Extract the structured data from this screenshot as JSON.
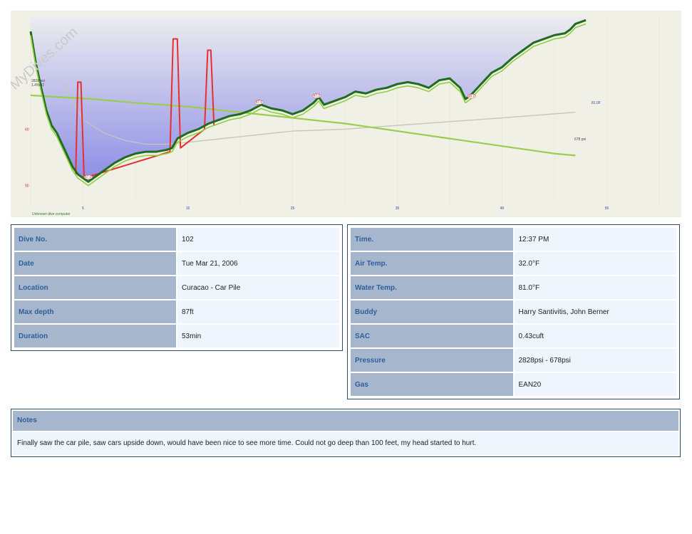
{
  "watermark": "MyDives.com",
  "chart_data": {
    "type": "line",
    "xlim": [
      0,
      60
    ],
    "ylim": [
      0,
      100
    ],
    "x_ticks": [
      "5",
      "15",
      "25",
      "35",
      "45",
      "55"
    ],
    "y_ticks": [
      "60",
      "90"
    ],
    "computer_label": "Unknown dive computer",
    "annotations": [
      {
        "x": 5.5,
        "y": 87.0,
        "label": "87.0"
      },
      {
        "x": 21.8,
        "y": 47.2,
        "label": "47.0"
      },
      {
        "x": 27.3,
        "y": 43.8,
        "label": "47.0"
      },
      {
        "x": 42.1,
        "y": 44.0,
        "label": "46.0"
      }
    ],
    "series": [
      {
        "color": "#1f6b1f",
        "x": [
          0,
          0.5,
          1,
          1.5,
          2,
          2.5,
          3,
          3.5,
          4,
          4.5,
          5,
          5.5,
          6,
          7,
          8,
          9,
          10,
          11,
          12,
          13,
          13.5,
          14,
          15,
          16,
          17,
          18,
          19,
          20,
          21,
          22,
          23,
          24,
          25,
          26,
          27,
          27.5,
          28,
          29,
          30,
          31,
          32,
          33,
          34,
          35,
          36,
          37,
          38,
          39,
          40,
          41,
          41.5,
          42,
          43,
          44,
          45,
          46,
          47,
          48,
          49,
          50,
          51,
          51.5,
          52,
          53
        ],
        "y": [
          8,
          25,
          38,
          50,
          58,
          62,
          68,
          74,
          80,
          84,
          86,
          88,
          86,
          82,
          78,
          75,
          73,
          72,
          72,
          71,
          70,
          65,
          62,
          60,
          57,
          55,
          53,
          52,
          50,
          47,
          49,
          50,
          52,
          50,
          46,
          43,
          47,
          45,
          43,
          40,
          41,
          39,
          38,
          36,
          35,
          36,
          38,
          34,
          33,
          38,
          44,
          42,
          36,
          30,
          27,
          22,
          18,
          14,
          12,
          10,
          9,
          7,
          4,
          2
        ]
      },
      {
        "color": "#8fcf3f",
        "x": [
          0,
          0.5,
          1,
          1.5,
          2,
          2.5,
          3,
          3.5,
          4,
          4.5,
          5,
          5.5,
          6,
          7,
          8,
          9,
          10,
          11,
          12,
          13,
          13.5,
          14,
          15,
          16,
          17,
          18,
          19,
          20,
          21,
          22,
          23,
          24,
          25,
          26,
          27,
          27.5,
          28,
          29,
          30,
          31,
          32,
          33,
          34,
          35,
          36,
          37,
          38,
          39,
          40,
          41,
          41.5,
          42,
          43,
          44,
          45,
          46,
          47,
          48,
          49,
          50,
          51,
          51.5,
          52,
          53
        ],
        "y": [
          10,
          27,
          40,
          52,
          60,
          64,
          70,
          76,
          82,
          86,
          88,
          90,
          88,
          84,
          80,
          77,
          75,
          74,
          74,
          73,
          72,
          67,
          64,
          62,
          59,
          57,
          55,
          54,
          52,
          49,
          51,
          52,
          54,
          52,
          48,
          45,
          49,
          47,
          45,
          42,
          43,
          41,
          40,
          38,
          37,
          38,
          40,
          36,
          35,
          40,
          46,
          44,
          38,
          32,
          29,
          24,
          20,
          16,
          14,
          12,
          11,
          9,
          6,
          4
        ]
      },
      {
        "color": "#e53030",
        "x": [
          4.3,
          4.5,
          4.8,
          5.1,
          13.3,
          13.6,
          14.0,
          14.3,
          16.6,
          16.9,
          17.2,
          17.5
        ],
        "y": [
          84,
          35,
          35,
          86,
          72,
          12,
          12,
          70,
          60,
          18,
          18,
          58
        ]
      },
      {
        "color": "#9acd4b",
        "x": [
          0,
          3,
          6,
          10,
          15,
          20,
          25,
          30,
          35,
          40,
          45,
          50,
          52
        ],
        "y": [
          42,
          43,
          44,
          46,
          48,
          51,
          54,
          57,
          61,
          65,
          69,
          73,
          74
        ]
      },
      {
        "color": "#c8c4be",
        "x": [
          3,
          5,
          7,
          9,
          11,
          13,
          15,
          20,
          25,
          30,
          35,
          40,
          45,
          52
        ],
        "y": [
          35,
          55,
          62,
          66,
          68,
          68,
          67,
          64,
          61,
          60,
          58,
          56,
          54,
          51
        ]
      }
    ],
    "pressure_start_label": "2828 psi",
    "pressure_start_sub": "1.4%O2",
    "pressure_end_label": "678 psi",
    "temp_end_label": "81.0F"
  },
  "dive_info": [
    {
      "label": "Dive No.",
      "value": "102"
    },
    {
      "label": "Date",
      "value": "Tue Mar 21, 2006"
    },
    {
      "label": "Location",
      "value": "Curacao - Car Pile"
    },
    {
      "label": "Max depth",
      "value": "87ft"
    },
    {
      "label": "Duration",
      "value": "53min"
    }
  ],
  "conditions": [
    {
      "label": "Time.",
      "value": "12:37 PM"
    },
    {
      "label": "Air Temp.",
      "value": "32.0°F"
    },
    {
      "label": "Water Temp.",
      "value": "81.0°F"
    },
    {
      "label": "Buddy",
      "value": "Harry Santivitis, John Berner"
    },
    {
      "label": "SAC",
      "value": "0.43cuft"
    },
    {
      "label": "Pressure",
      "value": "2828psi - 678psi"
    },
    {
      "label": "Gas",
      "value": "EAN20"
    }
  ],
  "notes": {
    "title": "Notes",
    "text": "Finally saw the car pile, saw cars upside down, would have been nice to see more time. Could not go deep than 100 feet, my head started to hurt."
  },
  "colors": {
    "plot_bg": "#f1f0e6",
    "fill_top": "#ececf0",
    "fill_bottom": "#8c8ce6",
    "label_bg": "#a5b6cd",
    "value_bg": "#eef5fc",
    "border": "#2f4a66"
  }
}
